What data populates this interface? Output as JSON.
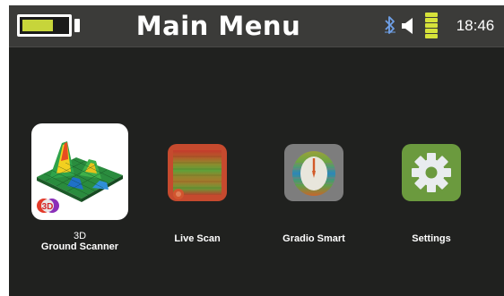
{
  "header": {
    "title": "Main Menu",
    "time": "18:46",
    "battery_level": 0.7
  },
  "status_icons": [
    "bluetooth-icon",
    "speaker-icon",
    "signal-bars-icon"
  ],
  "apps": [
    {
      "label_line1": "3D",
      "label_line2": "Ground Scanner",
      "icon": "3d-surface-plot-icon",
      "selected": true
    },
    {
      "label_line1": "",
      "label_line2": "Live Scan",
      "icon": "live-scan-gradient-icon"
    },
    {
      "label_line1": "",
      "label_line2": "Gradio Smart",
      "icon": "gradio-smart-gauge-icon"
    },
    {
      "label_line1": "",
      "label_line2": "Settings",
      "icon": "gear-icon"
    }
  ],
  "colors": {
    "background": "#20211f",
    "topbar": "#3b3b39",
    "battery_fill": "#c7d53a",
    "live_scan_frame": "#c64a2e",
    "gradio_frame": "#7d7d7d",
    "settings_frame": "#6b9a3e"
  }
}
